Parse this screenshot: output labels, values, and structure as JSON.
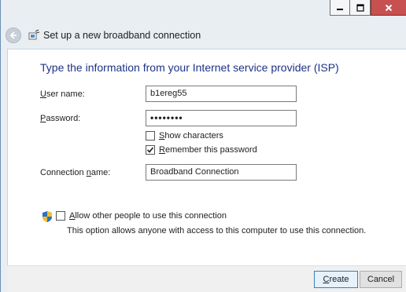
{
  "window": {
    "title": "Set up a new broadband connection",
    "caption": {
      "minimize_icon": "minimize-icon",
      "maximize_icon": "maximize-icon",
      "close_icon": "close-icon"
    }
  },
  "main": {
    "heading": "Type the information from your Internet service provider (ISP)",
    "user_name": {
      "label_prefix": "U",
      "label_rest": "ser name:",
      "value": "b1ereg55"
    },
    "password": {
      "label_prefix": "P",
      "label_rest": "assword:",
      "value": "••••••••"
    },
    "show_characters": {
      "prefix": "S",
      "rest": "how characters",
      "checked": false
    },
    "remember_password": {
      "prefix": "R",
      "rest": "emember this password",
      "checked": true
    },
    "connection_name": {
      "label_before": "Connection ",
      "label_accel": "n",
      "label_after": "ame:",
      "value": "Broadband Connection"
    },
    "allow_others": {
      "prefix": "A",
      "rest": "llow other people to use this connection",
      "checked": false,
      "description": "This option allows anyone with access to this computer to use this connection."
    }
  },
  "footer": {
    "create": {
      "prefix": "C",
      "rest": "reate"
    },
    "cancel_label": "Cancel"
  },
  "colors": {
    "heading": "#1e3287",
    "close_button": "#c75050",
    "frame": "#e9eef3"
  }
}
